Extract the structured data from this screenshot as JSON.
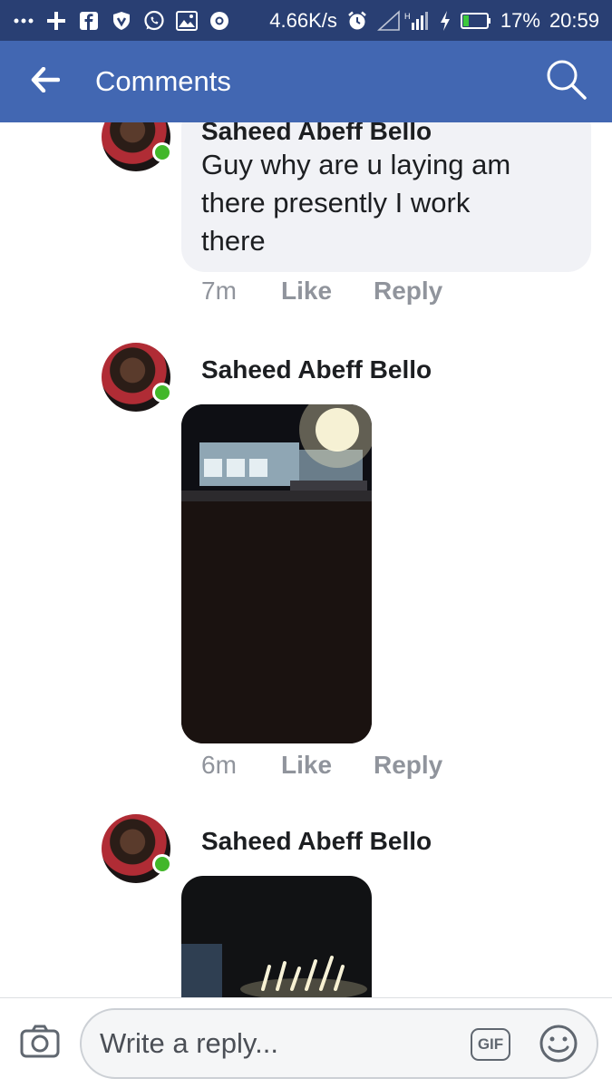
{
  "status_bar": {
    "network_speed": "4.66K/s",
    "battery": "17%",
    "time": "20:59",
    "left_icons": [
      "more-icon",
      "plus-icon",
      "facebook-icon",
      "vpn-shield-icon",
      "whatsapp-icon",
      "gallery-icon",
      "chrome-icon"
    ],
    "right_icons": [
      "alarm-icon",
      "signal-icon",
      "charging-icon",
      "battery-icon"
    ]
  },
  "app_bar": {
    "title": "Comments",
    "back_icon": "arrow-left-icon",
    "search_icon": "search-icon",
    "color": "#4267b2"
  },
  "comments": [
    {
      "author": "Saheed Abeff Bello",
      "text": "Guy why are u laying am there presently I work there",
      "lines": [
        "Guy why are u laying am",
        "there presently I work",
        "there"
      ],
      "time": "7m",
      "like_label": "Like",
      "reply_label": "Reply",
      "online": true
    },
    {
      "author": "Saheed Abeff Bello",
      "attachment": "photo",
      "time": "6m",
      "like_label": "Like",
      "reply_label": "Reply",
      "online": true
    },
    {
      "author": "Saheed Abeff Bello",
      "attachment": "photo",
      "online": true
    }
  ],
  "reply_bar": {
    "placeholder": "Write a reply...",
    "gif_label": "GIF",
    "camera_icon": "camera-icon",
    "emoji_icon": "smiley-icon"
  },
  "colors": {
    "status_bar": "#293f73",
    "online": "#42b72a",
    "bubble": "#f1f2f6",
    "meta_text": "#90949c"
  }
}
